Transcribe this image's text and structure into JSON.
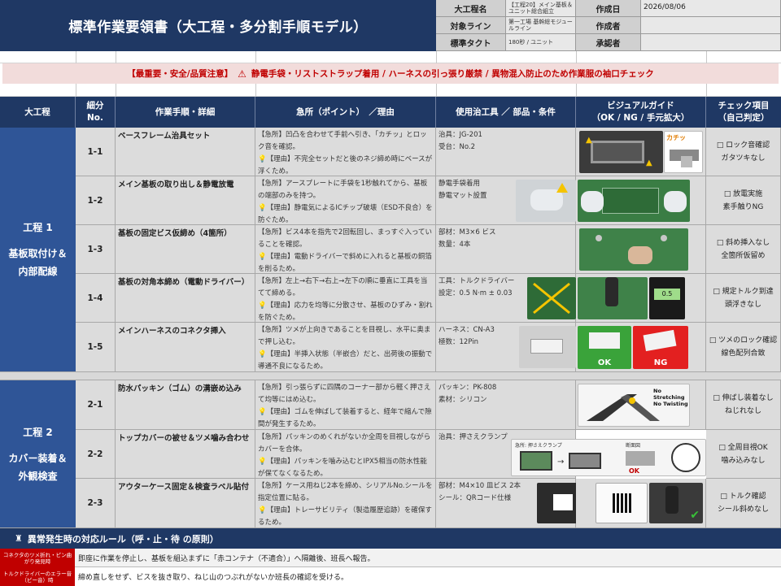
{
  "header": {
    "title": "標準作業要領書（大工程・多分割手順モデル）",
    "process_name_label": "大工程名",
    "process_name_value": "【工程20】メイン基板＆ユニット総合組立",
    "target_line_label": "対象ライン",
    "target_line_value": "第一工場 基幹総モジュールライン",
    "takt_label": "標準タクト",
    "takt_value": "180秒 / ユニット",
    "created_date_label": "作成日",
    "created_date_value": "2026/08/06",
    "author_label": "作成者",
    "author_value": "",
    "approver_label": "承認者",
    "approver_value": ""
  },
  "banner": {
    "prefix": "【最重要・安全/品質注意】",
    "warning_symbol": "⚠",
    "text": "静電手袋・リストストラップ着用 / ハーネスの引っ張り厳禁 / 異物混入防止のため作業服の袖口チェック"
  },
  "table_header": {
    "process": "大工程",
    "no_line1": "細分",
    "no_line2": "No.",
    "step": "作業手順・詳細",
    "point": "急所（ポイント）　／理由",
    "tool": "使用治工具 ／ 部品・条件",
    "visual_line1": "ビジュアルガイド",
    "visual_line2": "（OK / NG / 手元拡大）",
    "check_line1": "チェック項目",
    "check_line2": "（自己判定）"
  },
  "processes": [
    {
      "title_line1": "工程 1",
      "title_line2": "基板取付け＆",
      "title_line3": "内部配線",
      "rows": [
        {
          "no": "1-1",
          "step": "ベースフレーム治具セット",
          "point": "【急所】凹凸を合わせて手前へ引き、「カチッ」とロック音を確認。",
          "reason": "【理由】不完全セットだと後のネジ締め時にベースが浮くため。",
          "tool_line1": "治具：JG-201",
          "tool_line2": "受台：No.2",
          "visual_caption": "カチッ",
          "check_line1": "□ ロック音確認",
          "check_line2": "ガタツキなし"
        },
        {
          "no": "1-2",
          "step": "メイン基板の取り出し＆静電放電",
          "point": "【急所】アースプレートに手袋を1秒触れてから、基板の端部のみを持つ。",
          "reason": "【理由】静電気によるICチップ破壊（ESD不良合）を防ぐため。",
          "tool_line1": "静電手袋着用",
          "tool_line2": "静電マット設置",
          "visual_caption": "",
          "check_line1": "□ 放電実施",
          "check_line2": "素手触りNG"
        },
        {
          "no": "1-3",
          "step": "基板の固定ビス仮締め（4箇所）",
          "point": "【急所】ビス4本を指先で2回転回し、まっすぐ入っていることを確認。",
          "reason": "【理由】電動ドライバーで斜めに入れると基板の銅箔を削るため。",
          "tool_line1": "部材：M3×6 ビス",
          "tool_line2": "数量：4本",
          "visual_caption": "",
          "check_line1": "□ 斜め挿入なし",
          "check_line2": "全箇所仮留め"
        },
        {
          "no": "1-4",
          "step": "基板の対角本締め（電動ドライバー）",
          "point": "【急所】左上→右下→右上→左下の順に垂直に工具を当てて締める。",
          "reason": "【理由】応力を均等に分散させ、基板のひずみ・割れを防ぐため。",
          "tool_line1": "工具：トルクドライバー",
          "tool_line2": "設定：0.5 N·m ± 0.03",
          "visual_caption": "0.5",
          "check_line1": "□ 規定トルク到達",
          "check_line2": "頭浮きなし"
        },
        {
          "no": "1-5",
          "step": "メインハーネスのコネクタ挿入",
          "point": "【急所】ツメが上向きであることを目視し、水平に奥まで押し込む。",
          "reason": "【理由】半挿入状態（半嵌合）だと、出荷後の振動で導通不良になるため。",
          "tool_line1": "ハーネス：CN-A3",
          "tool_line2": "極数：12Pin",
          "visual_ok": "OK",
          "visual_ng": "NG",
          "check_line1": "□ ツメのロック確認",
          "check_line2": "線色配列合致"
        }
      ]
    },
    {
      "title_line1": "工程 2",
      "title_line2": "カバー装着＆",
      "title_line3": "外観検査",
      "rows": [
        {
          "no": "2-1",
          "step": "防水パッキン（ゴム）の溝嵌め込み",
          "point": "【急所】引っ張らずに四隅のコーナー部から軽く押さえて均等にはめ込む。",
          "reason": "【理由】ゴムを伸ばして装着すると、経年で縮んで隙間が発生するため。",
          "tool_line1": "パッキン：PK-808",
          "tool_line2": "素材：シリコン",
          "visual_caption_1": "No Stretching",
          "visual_caption_2": "No Twisting",
          "check_line1": "□ 伸ばし装着なし",
          "check_line2": "ねじれなし"
        },
        {
          "no": "2-2",
          "step": "トップカバーの被せ＆ツメ噛み合わせ",
          "point": "【急所】パッキンのめくれがないか全周を目視しながらカバーを合体。",
          "reason": "【理由】パッキンを噛み込むとIPX5相当の防水性能が保てなくなるため。",
          "tool_line1": "治具：押さえクランプ",
          "tool_line2": "",
          "visual_label_1": "急所: 押さえクランプ",
          "visual_label_2": "断面図",
          "visual_ok": "OK",
          "check_line1": "□ 全周目視OK",
          "check_line2": "噛み込みなし"
        },
        {
          "no": "2-3",
          "step": "アウターケース固定＆検査ラベル貼付",
          "point": "【急所】ケース用ねじ2本を締め、シリアルNo.シールを指定位置に貼る。",
          "reason": "【理由】トレーサビリティ（製造履歴追跡）を確保するため。",
          "tool_line1": "部材：M4×10 皿ビス 2本",
          "tool_line2": "シール：QRコード仕様",
          "visual_caption": "",
          "check_line1": "□ トルク確認",
          "check_line2": "シール斜めなし"
        }
      ]
    }
  ],
  "abnormal": {
    "title": "異常発生時の対応ルール（呼・止・待 の原則）",
    "rows": [
      {
        "label": "コネクタのツメ折れ・ピン曲がり発見時",
        "text": "即座に作業を停止し、基板を組込まずに「赤コンテナ（不適合）」へ隔離後、班長へ報告。"
      },
      {
        "label": "トルクドライバーのエラー音（ピー音）時",
        "text": "締め直しをせず、ビスを抜き取り、ねじ山のつぶれがないか班長の確認を受ける。"
      }
    ]
  }
}
